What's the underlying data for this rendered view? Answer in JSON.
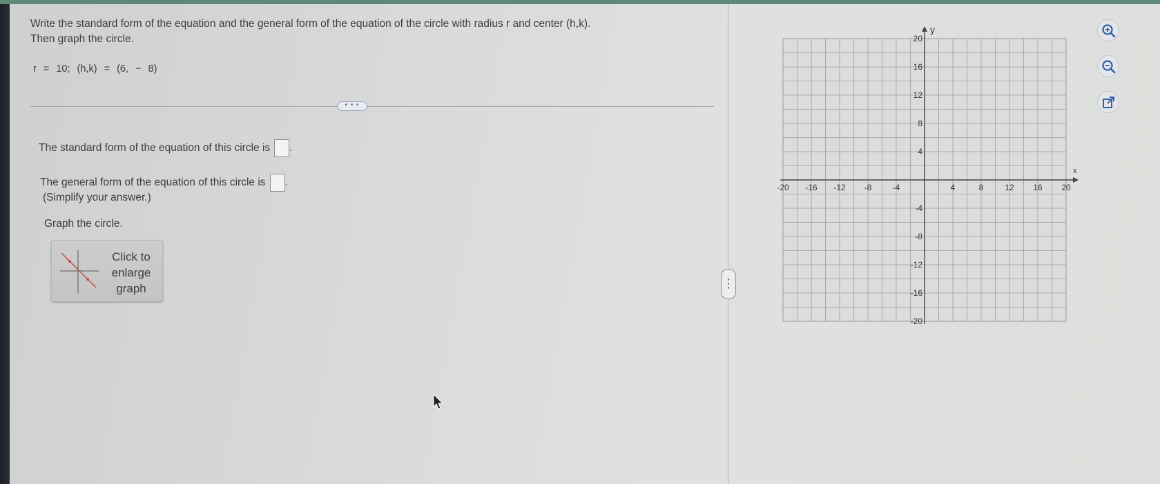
{
  "question": {
    "line1": "Write the standard form of the equation and the general form of the equation of the circle with radius r and center (h,k).",
    "line2": "Then graph the circle.",
    "given": "r = 10;   (h,k) = (6, − 8)"
  },
  "more_button": "• • •",
  "answers": {
    "standard_label": "The standard form of the equation of this circle is",
    "general_label": "The general form of the equation of this circle is",
    "simplify_note": "(Simplify your answer.)",
    "graph_prompt": "Graph the circle.",
    "period": "."
  },
  "enlarge_button": {
    "line1": "Click to",
    "line2": "enlarge",
    "line3": "graph"
  },
  "graph": {
    "x_axis_label": "x",
    "y_axis_label": "y",
    "x_range": [
      -20,
      20
    ],
    "y_range": [
      -20,
      20
    ],
    "grid_step": 2,
    "x_tick_labels": [
      "-20",
      "-16",
      "-12",
      "-8",
      "-4",
      "4",
      "8",
      "12",
      "16",
      "20"
    ],
    "y_tick_labels": [
      "20",
      "16",
      "12",
      "8",
      "4",
      "-4",
      "-8",
      "-12",
      "-16",
      "-20"
    ]
  },
  "tools": [
    "zoom-in-icon",
    "zoom-out-icon",
    "pop-out-icon"
  ],
  "colors": {
    "accent": "#5a6f94",
    "tool_icon": "#2f5fa8"
  }
}
